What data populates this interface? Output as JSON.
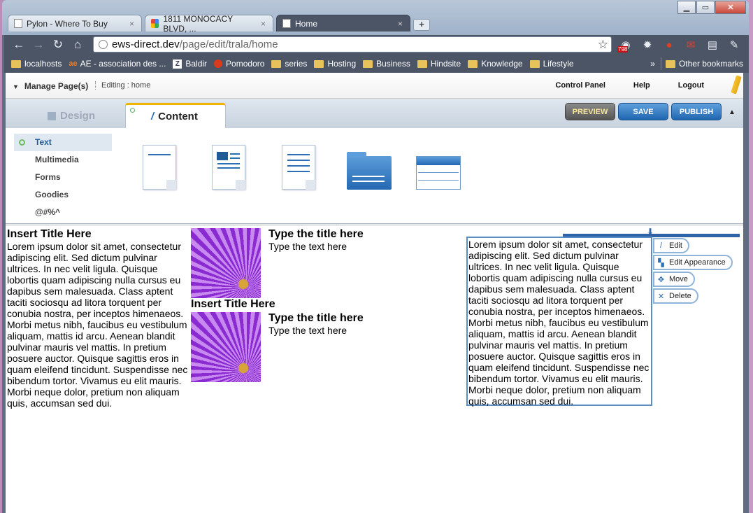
{
  "browser": {
    "tabs": [
      {
        "label": "Pylon - Where To Buy"
      },
      {
        "label": "1811 MONOCACY BLVD, ..."
      },
      {
        "label": "Home"
      }
    ],
    "tab_close": "×",
    "newtab": "+",
    "url_host": "ews-direct.dev",
    "url_path": "/page/edit/trala/home",
    "ext_badge": "798",
    "bookmarks": [
      {
        "label": "localhosts",
        "icon": "folder"
      },
      {
        "label": "AE - association des ...",
        "icon": "ae"
      },
      {
        "label": "Baldir",
        "icon": "z"
      },
      {
        "label": "Pomodoro",
        "icon": "tomato"
      },
      {
        "label": "series",
        "icon": "folder"
      },
      {
        "label": "Hosting",
        "icon": "folder"
      },
      {
        "label": "Business",
        "icon": "folder"
      },
      {
        "label": "Hindsite",
        "icon": "folder"
      },
      {
        "label": "Knowledge",
        "icon": "folder"
      },
      {
        "label": "Lifestyle",
        "icon": "folder"
      }
    ],
    "bookmarks_more": "»",
    "other_bookmarks": "Other bookmarks"
  },
  "cms": {
    "manage_label": "Manage Page(s)",
    "editing_label": "Editing : home",
    "links": [
      "Control Panel",
      "Help",
      "Logout"
    ],
    "design_tab": "Design",
    "content_tab": "Content",
    "preview": "PREVIEW",
    "save": "SAVE",
    "publish": "PUBLISH",
    "categories": [
      "Text",
      "Multimedia",
      "Forms",
      "Goodies",
      "@#%^"
    ]
  },
  "content": {
    "left_title": "Insert Title Here",
    "lorem": "Lorem ipsum dolor sit amet, consectetur adipiscing elit. Sed dictum pulvinar ultrices. In nec velit ligula. Quisque lobortis quam adipiscing nulla cursus eu dapibus sem malesuada. Class aptent taciti sociosqu ad litora torquent per conubia nostra, per inceptos himenaeos. Morbi metus nibh, faucibus eu vestibulum aliquam, mattis id arcu. Aenean blandit pulvinar mauris vel mattis. In pretium posuere auctor. Quisque sagittis eros in quam eleifend tincidunt. Suspendisse nec bibendum tortor. Vivamus eu elit mauris. Morbi neque dolor, pretium non aliquam quis, accumsan sed dui.",
    "block1_title": "Type the title here",
    "block1_text": "Type the text here",
    "mid_title": "Insert Title Here",
    "block2_title": "Type the title here",
    "block2_text": "Type the text here",
    "actions": [
      "Edit",
      "Edit Appearance",
      "Move",
      "Delete"
    ]
  }
}
